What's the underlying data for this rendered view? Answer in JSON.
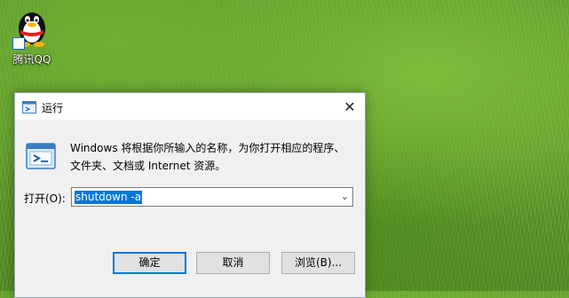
{
  "desktop": {
    "icons": [
      {
        "label": "腾讯QQ",
        "icon": "qq-penguin-icon"
      }
    ]
  },
  "dialog": {
    "title": "运行",
    "title_icon": "run-icon",
    "close_glyph": "✕",
    "description_line1": "Windows 将根据你所输入的名称，为你打开相应的程序、",
    "description_line2": "文件夹、文档或 Internet 资源。",
    "open_label": "打开(O):",
    "open_value": "shutdown -a",
    "dropdown_glyph": "⌄",
    "buttons": {
      "ok": "确定",
      "cancel": "取消",
      "browse": "浏览(B)..."
    },
    "accent_color": "#0078d7"
  }
}
